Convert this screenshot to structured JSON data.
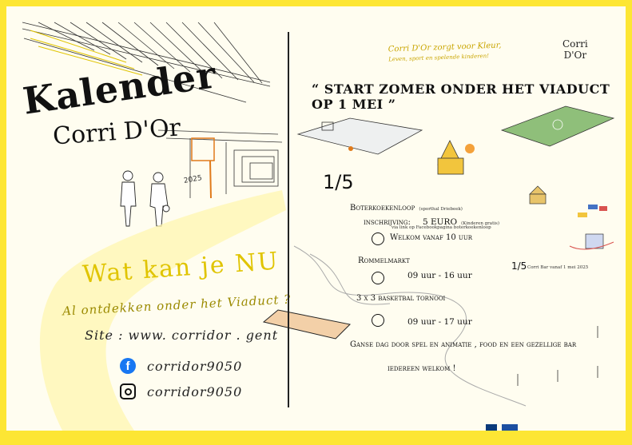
{
  "left": {
    "title_line1": "Kalender",
    "title_line2": "Corri D'Or",
    "year": "2025",
    "what_title": "Wat kan je NU",
    "what_sub": "Al ontdekken onder het Viaduct ?",
    "site": "Site :  www. corridor . gent",
    "facebook": "corridor9050",
    "instagram": "corridor9050"
  },
  "right": {
    "tagline_line1": "Corri D'Or zorgt voor Kleur,",
    "tagline_line2": "Leven, sport en spelende kinderen!",
    "logo_line1": "Corri",
    "logo_line2": "D'Or",
    "headline": "“ START ZOMER ONDER HET VIADUCT OP 1 MEI ”",
    "date_big": "1/5",
    "date_small": "1/5",
    "date_small_note": "Corri Bar vanaf 1 mei 2025",
    "events": {
      "run_title": "Boterkoekenloop",
      "run_sub": "(sporthal Driebeek)",
      "reg_label": "inschrijving:",
      "reg_price": "5 EURO",
      "reg_note": "(Kinderen gratis)",
      "reg_link": "via link op Facebookpagina boterkoekenloop",
      "run_time": "Welkom vanaf 10 uur",
      "market_title": "Rommelmarkt",
      "market_time": "09 uur - 16 uur",
      "basket_title": "3 x 3 basketbal tornooi",
      "basket_time": "09 uur - 17 uur",
      "day_text": "Ganse dag door spel en animatie , food en een gezellige bar",
      "welcome": "iedereen welkom !"
    }
  },
  "colors": {
    "frame": "#fde634",
    "accent": "#e0c400",
    "facebook": "#1877f2"
  }
}
